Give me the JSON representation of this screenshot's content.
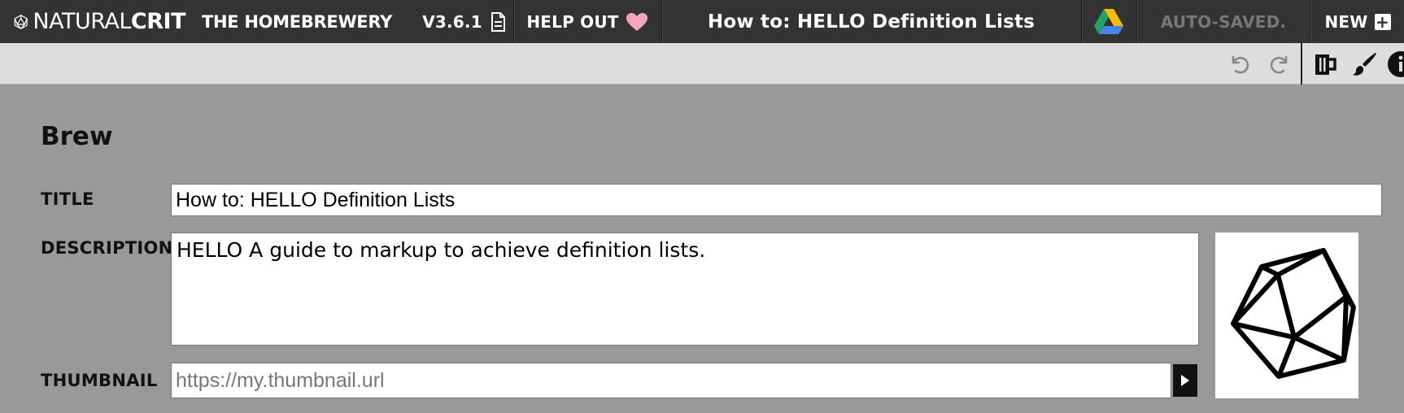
{
  "nav": {
    "logo_light": "NATURAL",
    "logo_bold": "CRIT",
    "brand": "THE HOMEBREWERY",
    "version": "V3.6.1",
    "help_out": "HELP OUT",
    "doc_title": "How to: HELLO Definition Lists",
    "autosaved": "AUTO-SAVED.",
    "new_label": "NEW",
    "new_plus": "+"
  },
  "toolbar": {
    "icons": [
      "undo-icon",
      "redo-icon",
      "brew-mug-icon",
      "paintbrush-icon",
      "info-icon"
    ]
  },
  "properties": {
    "heading": "Brew",
    "title_label": "TITLE",
    "title_value": "How to: HELLO Definition Lists",
    "description_label": "DESCRIPTION",
    "description_value": "HELLO A guide to markup to achieve definition lists.",
    "thumbnail_label": "THUMBNAIL",
    "thumbnail_placeholder": "https://my.thumbnail.url"
  },
  "colors": {
    "navbar_bg": "#333333",
    "toolbar_bg": "#dddddd",
    "panel_bg": "#999999",
    "heart": "#f4a6b8",
    "autosaved_text": "#777777"
  }
}
